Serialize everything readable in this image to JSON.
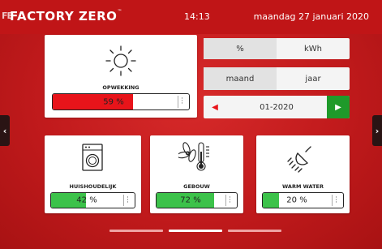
{
  "header": {
    "logo_mark": "FB",
    "brand": "FACTORY ZERO",
    "brand_mark": "™",
    "time": "14:13",
    "date": "maandag 27 januari 2020"
  },
  "nav": {
    "left_icon": "chevron-left-icon",
    "right_icon": "chevron-right-icon"
  },
  "production": {
    "icon": "sun-icon",
    "label": "OPWEKKING",
    "value_text": "59 %",
    "fraction": 0.59,
    "fill_color": "#e8141a"
  },
  "units": {
    "options": [
      "%",
      "kWh"
    ],
    "selected": "%"
  },
  "period": {
    "options": [
      "maand",
      "jaar"
    ],
    "selected": "maand"
  },
  "date_picker": {
    "value": "01-2020",
    "prev_icon": "caret-left-icon",
    "next_icon": "caret-right-icon",
    "prev_color": "#e8141a",
    "next_color": "#1f9a2a"
  },
  "consumers": [
    {
      "icon": "washing-machine-icon",
      "label": "HUISHOUDELIJK",
      "value_text": "42 %",
      "fraction": 0.42,
      "fill_color": "#3cc24a"
    },
    {
      "icon": "fan-thermometer-icon",
      "label": "GEBOUW",
      "value_text": "72 %",
      "fraction": 0.72,
      "fill_color": "#3cc24a"
    },
    {
      "icon": "shower-icon",
      "label": "WARM WATER",
      "value_text": "20 %",
      "fraction": 0.2,
      "fill_color": "#3cc24a"
    }
  ],
  "pager": {
    "pages": 3,
    "active": 1
  }
}
